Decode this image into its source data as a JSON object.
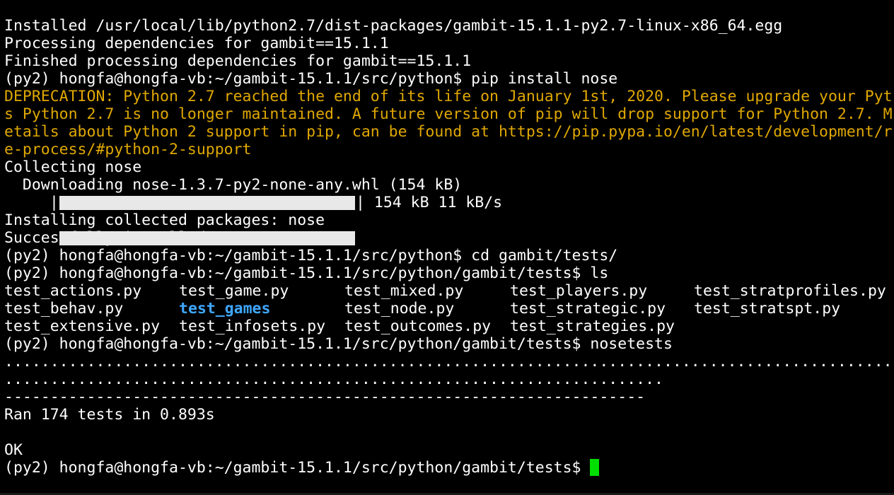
{
  "terminal": {
    "lines": [
      "Installed /usr/local/lib/python2.7/dist-packages/gambit-15.1.1-py2.7-linux-x86_64.egg",
      "Processing dependencies for gambit==15.1.1",
      "Finished processing dependencies for gambit==15.1.1",
      "(py2) hongfa@hongfa-vb:~/gambit-15.1.1/src/python$ pip install nose",
      "DEPRECATION: Python 2.7 reached the end of its life on January 1st, 2020. Please upgrade your Pyt",
      "s Python 2.7 is no longer maintained. A future version of pip will drop support for Python 2.7. M",
      "etails about Python 2 support in pip, can be found at https://pip.pypa.io/en/latest/development/r",
      "e-process/#python-2-support",
      "Collecting nose",
      "  Downloading nose-1.3.7-py2-none-any.whl (154 kB)",
      "Installing collected packages: nose",
      "Successfully installed nose-1.3.7",
      "(py2) hongfa@hongfa-vb:~/gambit-15.1.1/src/python$ cd gambit/tests/",
      "(py2) hongfa@hongfa-vb:~/gambit-15.1.1/src/python/gambit/tests$ ls",
      "(py2) hongfa@hongfa-vb:~/gambit-15.1.1/src/python/gambit/tests$ nosetests",
      ".................................................................................................",
      "........................................................................",
      "----------------------------------------------------------------------",
      "Ran 174 tests in 0.893s",
      "",
      "OK",
      "(py2) hongfa@hongfa-vb:~/gambit-15.1.1/src/python/gambit/tests$ "
    ],
    "progress": {
      "lead": "|",
      "trail": "| 154 kB 11 kB/s",
      "fraction": 1.0
    },
    "ls_rows": [
      [
        "test_actions.py",
        "test_game.py",
        "test_mixed.py",
        "test_players.py",
        "test_stratprofiles.py"
      ],
      [
        "test_behav.py",
        "test_games",
        "test_node.py",
        "test_strategic.py",
        "test_stratspt.py"
      ],
      [
        "test_extensive.py",
        "test_infosets.py",
        "test_outcomes.py",
        "test_strategies.py",
        ""
      ]
    ],
    "directory_entry": "test_games",
    "colors": {
      "background": "#000000",
      "foreground": "#ffffff",
      "warning": "#e0a800",
      "directory": "#3fa7ff",
      "cursor": "#00e000",
      "progress_bar": "#e8e8e8"
    }
  }
}
